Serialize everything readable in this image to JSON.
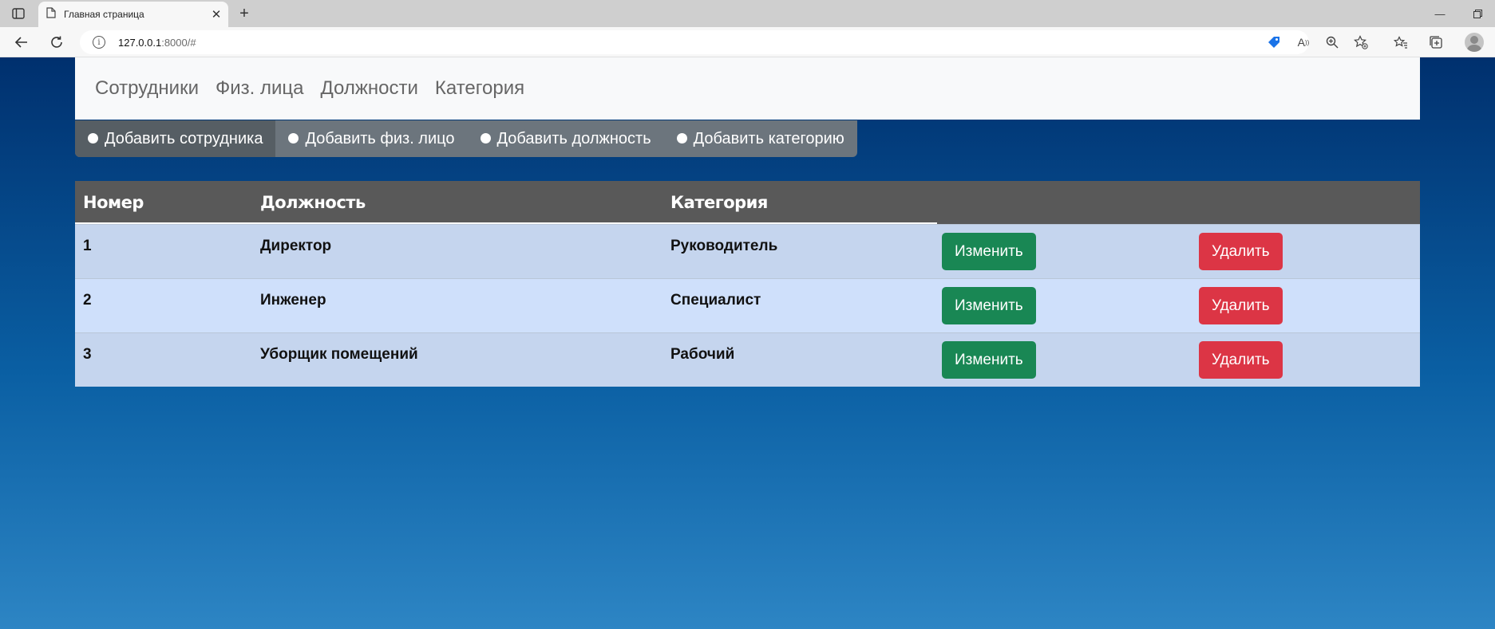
{
  "browser": {
    "tab_title": "Главная страница",
    "url_host": "127.0.0.1",
    "url_path": ":8000/#"
  },
  "nav": {
    "items": [
      "Сотрудники",
      "Физ. лица",
      "Должности",
      "Категория"
    ]
  },
  "actions": {
    "items": [
      "Добавить сотрудника",
      "Добавить физ. лицо",
      "Добавить должность",
      "Добавить категорию"
    ],
    "active_index": 0
  },
  "table": {
    "headers": [
      "Номер",
      "Должность",
      "Категория",
      "",
      ""
    ],
    "rows": [
      {
        "num": "1",
        "position": "Директор",
        "category": "Руководитель",
        "edit_label": "Изменить",
        "delete_label": "Удалить"
      },
      {
        "num": "2",
        "position": "Инженер",
        "category": "Специалист",
        "edit_label": "Изменить",
        "delete_label": "Удалить"
      },
      {
        "num": "3",
        "position": "Уборщик помещений",
        "category": "Рабочий",
        "edit_label": "Изменить",
        "delete_label": "Удалить"
      }
    ]
  },
  "colors": {
    "header_bg": "#595959",
    "row_odd": "#c5d5ee",
    "row_even": "#cfe0fb",
    "edit_button": "#198754",
    "delete_button": "#dc3545",
    "pill_bg": "#6c757d",
    "pill_active": "#565e64"
  }
}
